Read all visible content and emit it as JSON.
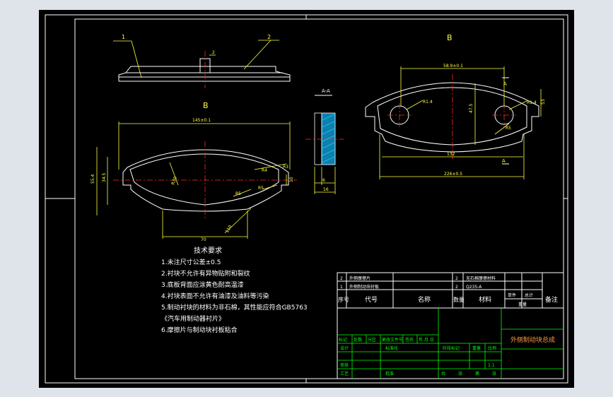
{
  "colors": {
    "background": "#000000",
    "frame": "#ffffff",
    "dimension": "#ffff40",
    "centerline": "#ff2a2a",
    "hatch": "#00ffff",
    "titleblock": "#00ff00",
    "window": "#dfe3ea"
  },
  "drawing": {
    "balloons": [
      "1",
      "2",
      "2"
    ],
    "view_labels": {
      "top_left": "B",
      "mid_left": "B",
      "section": "A-A",
      "right": "B",
      "right_a1": "A",
      "right_a2": "A"
    },
    "dims_left": [
      "145±0.1",
      "55.4",
      "34.5",
      "R30",
      "R4",
      "R5",
      "R5",
      "R3",
      "110",
      "10",
      "70"
    ],
    "dims_section": [
      "6",
      "16"
    ],
    "dims_right": [
      "58.9±0.1",
      "R1.4",
      "R1.4",
      "47.5",
      "132",
      "R5",
      "53",
      "226±0.5"
    ]
  },
  "tech": {
    "title": "技术要求",
    "items": [
      "1.未注尺寸公差±0.5",
      "2.衬块不允许有异物贴附和裂纹",
      "3.底板背面应涂黄色耐高温漆",
      "4.衬块表面不允许有油漆及油料等污染",
      "5.制动衬块的材料为非石棉，其性能应符合GB5763",
      "《汽车用制动器衬片》",
      "6.摩擦片与制动块衬板粘合"
    ]
  },
  "titleblock": {
    "bom": [
      {
        "seq": "2",
        "name": "外侧摩擦片",
        "qty": "2",
        "material": "无石棉摩擦材料"
      },
      {
        "seq": "1",
        "name": "外侧制动块衬板",
        "qty": "2",
        "material": "Q235-A"
      }
    ],
    "header": {
      "seq": "序号",
      "code": "代号",
      "name": "名称",
      "qty": "数量",
      "material": "材料",
      "unit_w": "单件",
      "total_w": "总计",
      "weight": "重量",
      "note": "备注"
    },
    "left_labels": [
      "标记",
      "处数",
      "分区",
      "更改文件号",
      "签名",
      "年.月.日",
      "设计",
      "标准化",
      "审核",
      "工艺",
      "批准"
    ],
    "mid_labels": [
      "阶段标记",
      "重量",
      "比例"
    ],
    "scale": "1:1",
    "sheet": [
      "共",
      "张",
      "第",
      "张"
    ],
    "drawing_title": "外侧制动块总成"
  }
}
